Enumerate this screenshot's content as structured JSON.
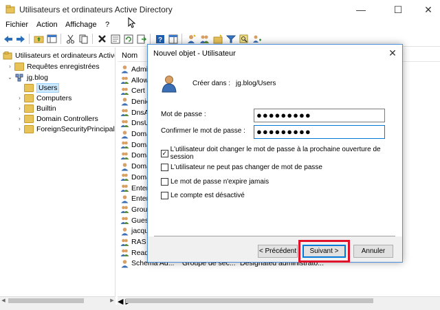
{
  "window": {
    "title": "Utilisateurs et ordinateurs Active Directory",
    "minimize_glyph": "—",
    "maximize_glyph": "☐",
    "close_glyph": "✕"
  },
  "menu": {
    "items": [
      "Fichier",
      "Action",
      "Affichage",
      "?"
    ]
  },
  "toolbar": {
    "icons": [
      "back-arrow-icon",
      "forward-arrow-icon",
      "up-folder-icon",
      "console-tree-icon",
      "cut-icon",
      "copy-icon",
      "delete-icon",
      "properties-icon",
      "refresh-icon",
      "export-icon",
      "help-icon",
      "show-pane-icon",
      "new-user-icon",
      "new-group-icon",
      "new-ou-icon",
      "filter-icon",
      "find-icon",
      "add-to-group-icon"
    ]
  },
  "tree": {
    "root": "Utilisateurs et ordinateurs Active",
    "saved_queries": "Requêtes enregistrées",
    "domain": "jg.blog",
    "children": [
      "Users",
      "Computers",
      "Builtin",
      "Domain Controllers",
      "ForeignSecurityPrincipals"
    ],
    "selected": "Users"
  },
  "list": {
    "header_name": "Nom",
    "rows": [
      {
        "name": "Admi",
        "type": "",
        "desc": ""
      },
      {
        "name": "Allow",
        "type": "",
        "desc": ""
      },
      {
        "name": "Cert F",
        "type": "",
        "desc": ""
      },
      {
        "name": "Denie",
        "type": "",
        "desc": ""
      },
      {
        "name": "DnsA",
        "type": "",
        "desc": ""
      },
      {
        "name": "DnsU",
        "type": "",
        "desc": ""
      },
      {
        "name": "Doma",
        "type": "",
        "desc": ""
      },
      {
        "name": "Doma",
        "type": "",
        "desc": ""
      },
      {
        "name": "Doma",
        "type": "",
        "desc": ""
      },
      {
        "name": "Doma",
        "type": "",
        "desc": ""
      },
      {
        "name": "Doma",
        "type": "",
        "desc": ""
      },
      {
        "name": "Enter",
        "type": "",
        "desc": ""
      },
      {
        "name": "Enter",
        "type": "",
        "desc": ""
      },
      {
        "name": "Group",
        "type": "",
        "desc": ""
      },
      {
        "name": "Guest",
        "type": "",
        "desc": ""
      },
      {
        "name": "jacqu",
        "type": "",
        "desc": ""
      },
      {
        "name": "RAS a",
        "type": "",
        "desc": ""
      },
      {
        "name": "Read-",
        "type": "",
        "desc": ""
      },
      {
        "name": "Schema Ad...",
        "type": "Groupe de séc...",
        "desc": "Designated administrato..."
      }
    ]
  },
  "dialog": {
    "title": "Nouvel objet - Utilisateur",
    "close_glyph": "✕",
    "created_in_label": "Créer dans :",
    "created_in_value": "jg.blog/Users",
    "password_label": "Mot de passe :",
    "password_value": "●●●●●●●●●",
    "confirm_label": "Confirmer le mot de passe :",
    "confirm_value": "●●●●●●●●●",
    "options": [
      {
        "label": "L'utilisateur doit changer le mot de passe à la prochaine ouverture de session",
        "checked": true
      },
      {
        "label": "L'utilisateur ne peut pas changer de mot de passe",
        "checked": false
      },
      {
        "label": "Le mot de passe n'expire jamais",
        "checked": false
      },
      {
        "label": "Le compte est désactivé",
        "checked": false
      }
    ],
    "buttons": {
      "previous": "< Précédent",
      "next": "Suivant >",
      "cancel": "Annuler"
    },
    "highlight_color": "#e0102a"
  }
}
